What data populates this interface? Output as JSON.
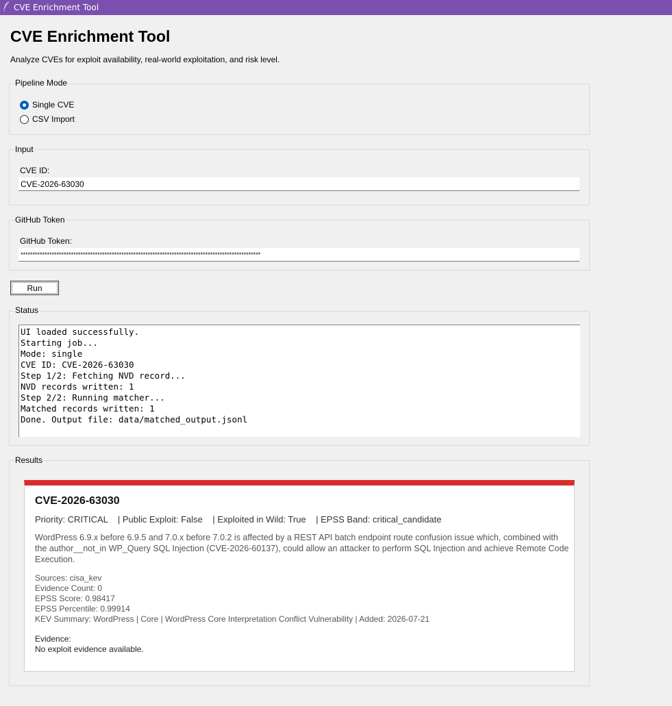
{
  "window": {
    "title": "CVE Enrichment Tool"
  },
  "header": {
    "title": "CVE Enrichment Tool",
    "subtitle": "Analyze CVEs for exploit availability, real-world exploitation, and risk level."
  },
  "pipeline_mode": {
    "label": "Pipeline Mode",
    "options": [
      {
        "label": "Single CVE",
        "selected": true
      },
      {
        "label": "CSV Import",
        "selected": false
      }
    ]
  },
  "input": {
    "label": "Input",
    "cve_id_label": "CVE ID:",
    "cve_id_value": "CVE-2026-63030"
  },
  "github": {
    "label": "GitHub Token",
    "token_label": "GitHub Token:",
    "token_value": "****************************************************************************************************"
  },
  "run_button": {
    "label": "Run"
  },
  "status": {
    "label": "Status",
    "log": "UI loaded successfully.\nStarting job...\nMode: single\nCVE ID: CVE-2026-63030\nStep 1/2: Fetching NVD record...\nNVD records written: 1\nStep 2/2: Running matcher...\nMatched records written: 1\nDone. Output file: data/matched_output.jsonl"
  },
  "results": {
    "label": "Results",
    "accent_color": "#d92b2b",
    "card": {
      "cve_id": "CVE-2026-63030",
      "summary_line": "Priority: CRITICAL    | Public Exploit: False    | Exploited in Wild: True    | EPSS Band: critical_candidate",
      "description": "WordPress 6.9.x before 6.9.5 and 7.0.x before 7.0.2 is affected by a REST API batch endpoint route confusion issue which, combined with the author__not_in WP_Query SQL Injection (CVE-2026-60137), could allow an attacker to perform SQL Injection and achieve Remote Code Execution.",
      "sources": "Sources: cisa_kev",
      "evidence_count": "Evidence Count: 0",
      "epss_score": "EPSS Score: 0.98417",
      "epss_percentile": "EPSS Percentile: 0.99914",
      "kev_summary": "KEV Summary: WordPress | Core | WordPress Core Interpretation Conflict Vulnerability | Added: 2026-07-21",
      "evidence_label": "Evidence:",
      "evidence_text": "No exploit evidence available."
    }
  }
}
